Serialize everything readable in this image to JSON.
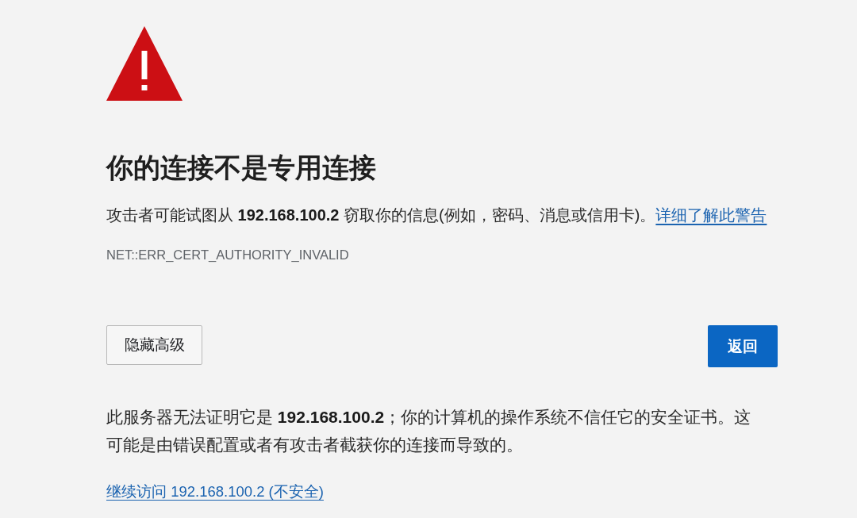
{
  "warning": {
    "title": "你的连接不是专用连接",
    "message": "攻击者可能试图从 **192.168.100.2** 窃取你的信息(例如，密码、消息或信用卡)。",
    "learn_more_link": "详细了解此警告",
    "error_code": "NET::ERR_CERT_AUTHORITY_INVALID"
  },
  "buttons": [
    {
      "label": "隐藏高级",
      "kind": "secondary"
    },
    {
      "label": "返回",
      "kind": "primary"
    }
  ],
  "details": {
    "text": "此服务器无法证明它是 **192.168.100.2**；你的计算机的操作系统不信任它的安全证书。这可能是由错误配置或者有攻击者截获你的连接而导致的。",
    "proceed_link": "继续访问 192.168.100.2 (不安全)"
  }
}
